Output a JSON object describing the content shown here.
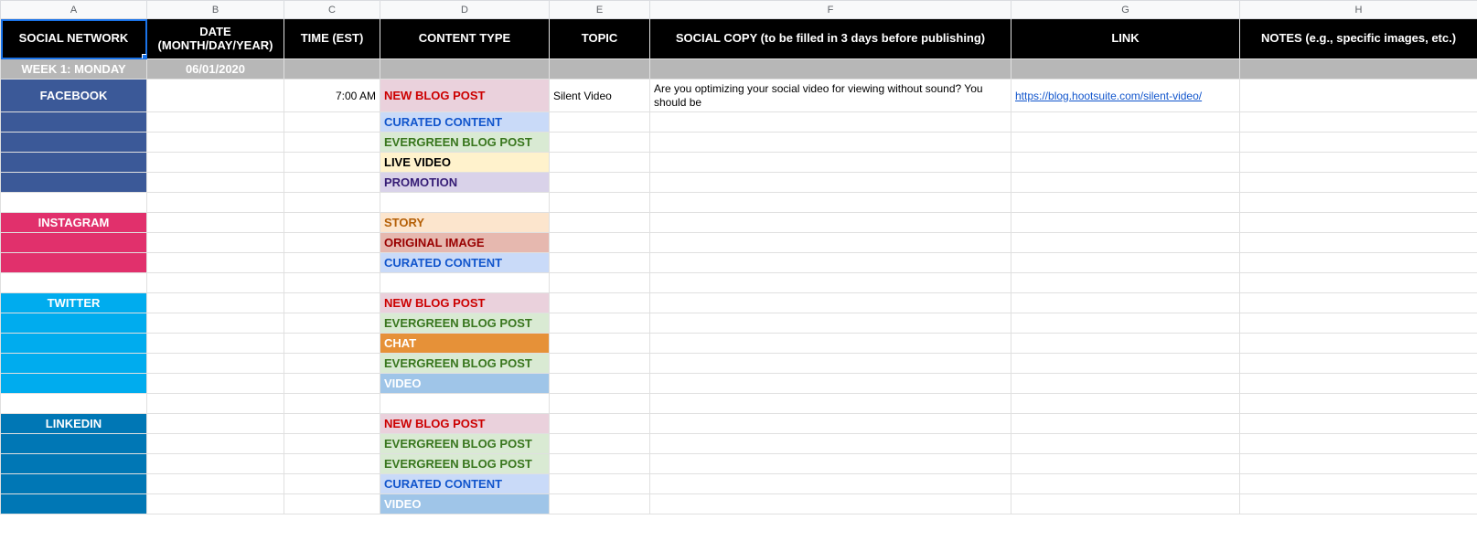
{
  "columns": [
    "A",
    "B",
    "C",
    "D",
    "E",
    "F",
    "G",
    "H"
  ],
  "headers": {
    "A": "SOCIAL NETWORK",
    "B": "DATE (MONTH/DAY/YEAR)",
    "C": "TIME (EST)",
    "D": "CONTENT TYPE",
    "E": "TOPIC",
    "F": "SOCIAL COPY (to be filled in 3 days before publishing)",
    "G": "LINK",
    "H": "NOTES (e.g., specific images, etc.)"
  },
  "section": {
    "label": "WEEK 1: MONDAY",
    "date": "06/01/2020"
  },
  "networks": [
    {
      "id": "facebook",
      "label": "FACEBOOK",
      "bg": "net-facebook",
      "rows": [
        {
          "time": "7:00 AM",
          "tag": "NEW BLOG POST",
          "tagClass": "tag-newblog",
          "topic": "Silent Video",
          "copy": "Are you optimizing your social video for viewing without sound? You should be",
          "link": "https://blog.hootsuite.com/silent-video/"
        },
        {
          "tag": "CURATED CONTENT",
          "tagClass": "tag-curated"
        },
        {
          "tag": "EVERGREEN BLOG POST",
          "tagClass": "tag-evergreen"
        },
        {
          "tag": "LIVE VIDEO",
          "tagClass": "tag-livevideo"
        },
        {
          "tag": "PROMOTION",
          "tagClass": "tag-promotion"
        }
      ]
    },
    {
      "id": "instagram",
      "label": "INSTAGRAM",
      "bg": "net-instagram",
      "rows": [
        {
          "tag": "STORY",
          "tagClass": "tag-story"
        },
        {
          "tag": "ORIGINAL IMAGE",
          "tagClass": "tag-origimg"
        },
        {
          "tag": "CURATED CONTENT",
          "tagClass": "tag-curated"
        }
      ]
    },
    {
      "id": "twitter",
      "label": "TWITTER",
      "bg": "net-twitter",
      "rows": [
        {
          "tag": "NEW BLOG POST",
          "tagClass": "tag-newblog"
        },
        {
          "tag": "EVERGREEN BLOG POST",
          "tagClass": "tag-evergreen"
        },
        {
          "tag": "CHAT",
          "tagClass": "tag-chat"
        },
        {
          "tag": "EVERGREEN BLOG POST",
          "tagClass": "tag-evergreen"
        },
        {
          "tag": "VIDEO",
          "tagClass": "tag-video"
        }
      ]
    },
    {
      "id": "linkedin",
      "label": "LINKEDIN",
      "bg": "net-linkedin",
      "rows": [
        {
          "tag": "NEW BLOG POST",
          "tagClass": "tag-newblog"
        },
        {
          "tag": "EVERGREEN BLOG POST",
          "tagClass": "tag-evergreen"
        },
        {
          "tag": "EVERGREEN BLOG POST",
          "tagClass": "tag-evergreen"
        },
        {
          "tag": "CURATED CONTENT",
          "tagClass": "tag-curated"
        },
        {
          "tag": "VIDEO",
          "tagClass": "tag-video"
        }
      ]
    }
  ]
}
